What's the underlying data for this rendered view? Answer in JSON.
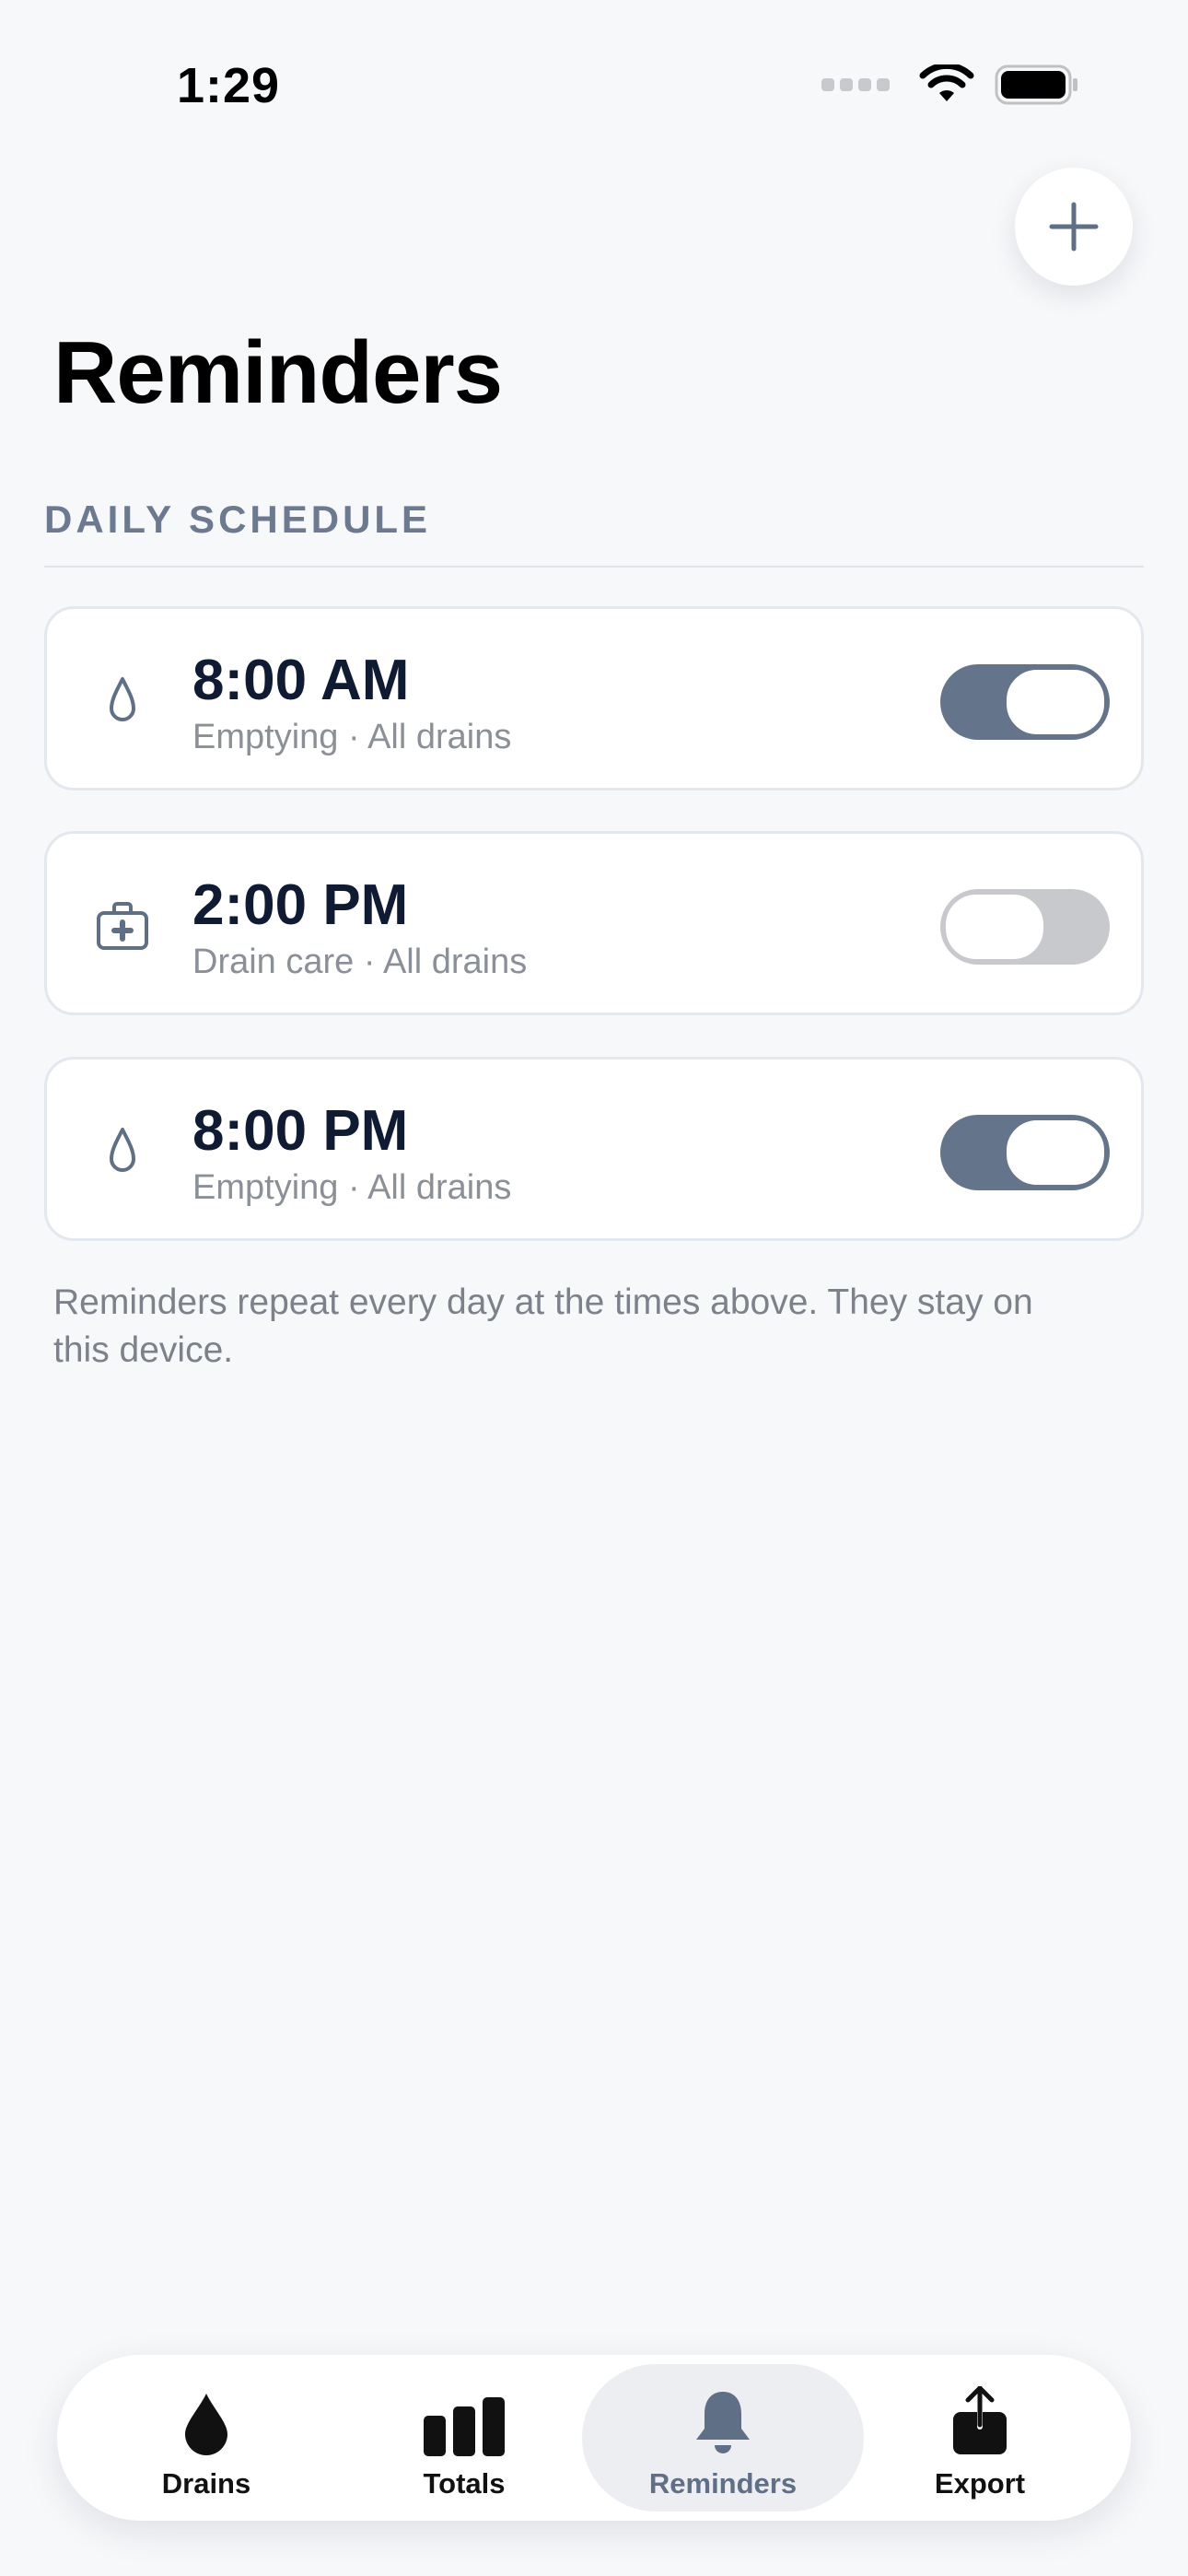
{
  "status_bar": {
    "time": "1:29"
  },
  "header": {
    "title": "Reminders",
    "add_button_label": "+"
  },
  "section": {
    "title": "DAILY SCHEDULE"
  },
  "reminders": [
    {
      "time": "8:00 AM",
      "subtitle": "Emptying · All drains",
      "icon": "drop-icon",
      "enabled": true
    },
    {
      "time": "2:00 PM",
      "subtitle": "Drain care · All drains",
      "icon": "first-aid-kit-icon",
      "enabled": false
    },
    {
      "time": "8:00 PM",
      "subtitle": "Emptying · All drains",
      "icon": "drop-icon",
      "enabled": true
    }
  ],
  "footnote": "Reminders repeat every day at the times above. They stay on this device.",
  "tabs": [
    {
      "label": "Drains",
      "icon": "drop-icon",
      "active": false
    },
    {
      "label": "Totals",
      "icon": "bar-chart-icon",
      "active": false
    },
    {
      "label": "Reminders",
      "icon": "bell-icon",
      "active": true
    },
    {
      "label": "Export",
      "icon": "share-icon",
      "active": false
    }
  ],
  "colors": {
    "accent": "#64748b",
    "toggle_off": "#c8c9cc",
    "background": "#f7f8fa"
  }
}
